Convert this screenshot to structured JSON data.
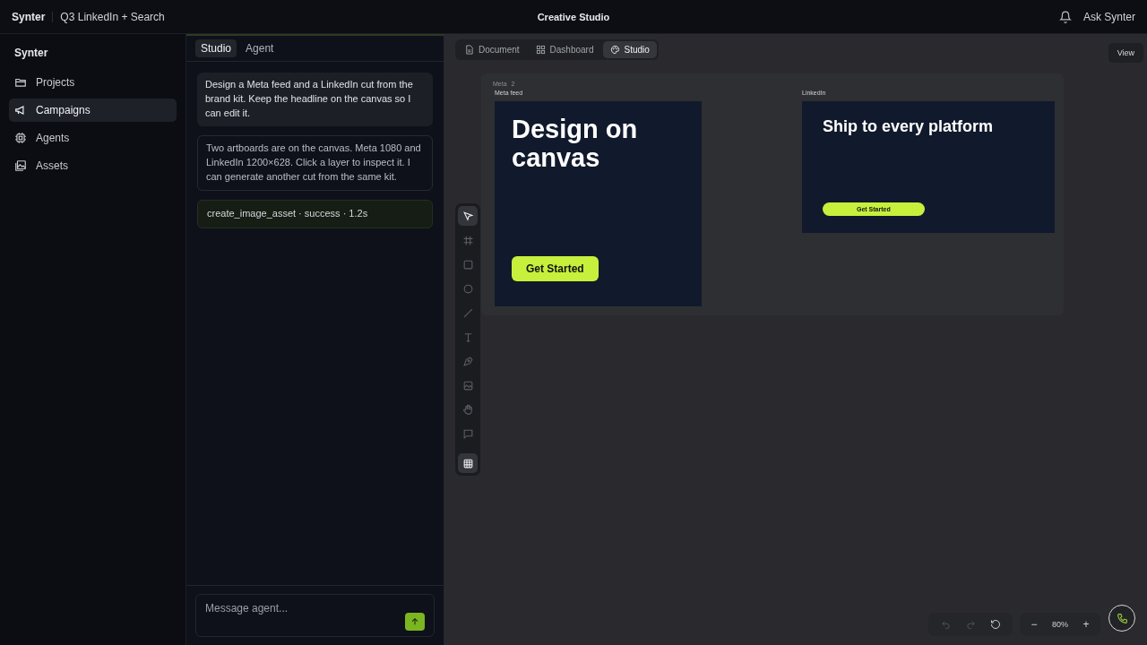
{
  "topbar": {
    "brand": "Synter",
    "project": "Q3 LinkedIn + Search",
    "title": "Creative Studio",
    "ask": "Ask Synter"
  },
  "sidebar": {
    "title": "Synter",
    "items": [
      {
        "label": "Projects",
        "kind": "folder",
        "selected": false
      },
      {
        "label": "Campaigns",
        "kind": "megaphone",
        "selected": true
      },
      {
        "label": "Agents",
        "kind": "chip",
        "selected": false
      },
      {
        "label": "Assets",
        "kind": "image",
        "selected": false
      }
    ]
  },
  "chat": {
    "tabs": [
      {
        "label": "Studio",
        "selected": true
      },
      {
        "label": "Agent",
        "selected": false
      }
    ],
    "messages": [
      {
        "kind": "user",
        "text": "Design a Meta feed and a LinkedIn cut from the brand kit. Keep the headline on the canvas so I can edit it."
      },
      {
        "kind": "assistant",
        "text": "Two artboards are on the canvas. Meta 1080 and LinkedIn 1200×628. Click a layer to inspect it. I can generate another cut from the same kit."
      },
      {
        "kind": "tool",
        "text": "create_image_asset · success · 1.2s"
      }
    ],
    "composer": {
      "placeholder": "Message agent..."
    }
  },
  "view_tabs": [
    {
      "label": "Document",
      "kind": "document",
      "selected": false
    },
    {
      "label": "Dashboard",
      "kind": "dashboard",
      "selected": false
    },
    {
      "label": "Studio",
      "kind": "palette",
      "selected": true
    }
  ],
  "view_button": "View",
  "canvas": {
    "frame_label": "Meta",
    "frame_count": "2",
    "artboards": [
      {
        "kind": "square",
        "label": "Meta feed",
        "headline": "Design on canvas",
        "cta": "Get Started"
      },
      {
        "kind": "wide",
        "label": "LinkedIn",
        "headline": "Ship to every platform",
        "cta": "Get Started"
      }
    ]
  },
  "tools": [
    {
      "kind": "select",
      "selected": true
    },
    {
      "kind": "frame",
      "selected": false
    },
    {
      "kind": "rect",
      "selected": false
    },
    {
      "kind": "ellipse",
      "selected": false
    },
    {
      "kind": "line",
      "selected": false
    },
    {
      "kind": "text",
      "selected": false
    },
    {
      "kind": "pen",
      "selected": false
    },
    {
      "kind": "image",
      "selected": false
    },
    {
      "kind": "hand",
      "selected": false
    },
    {
      "kind": "comment",
      "selected": false
    },
    {
      "kind": "grid",
      "selected": true
    }
  ],
  "zoom": {
    "minus": "−",
    "value": "80%",
    "plus": "+"
  }
}
